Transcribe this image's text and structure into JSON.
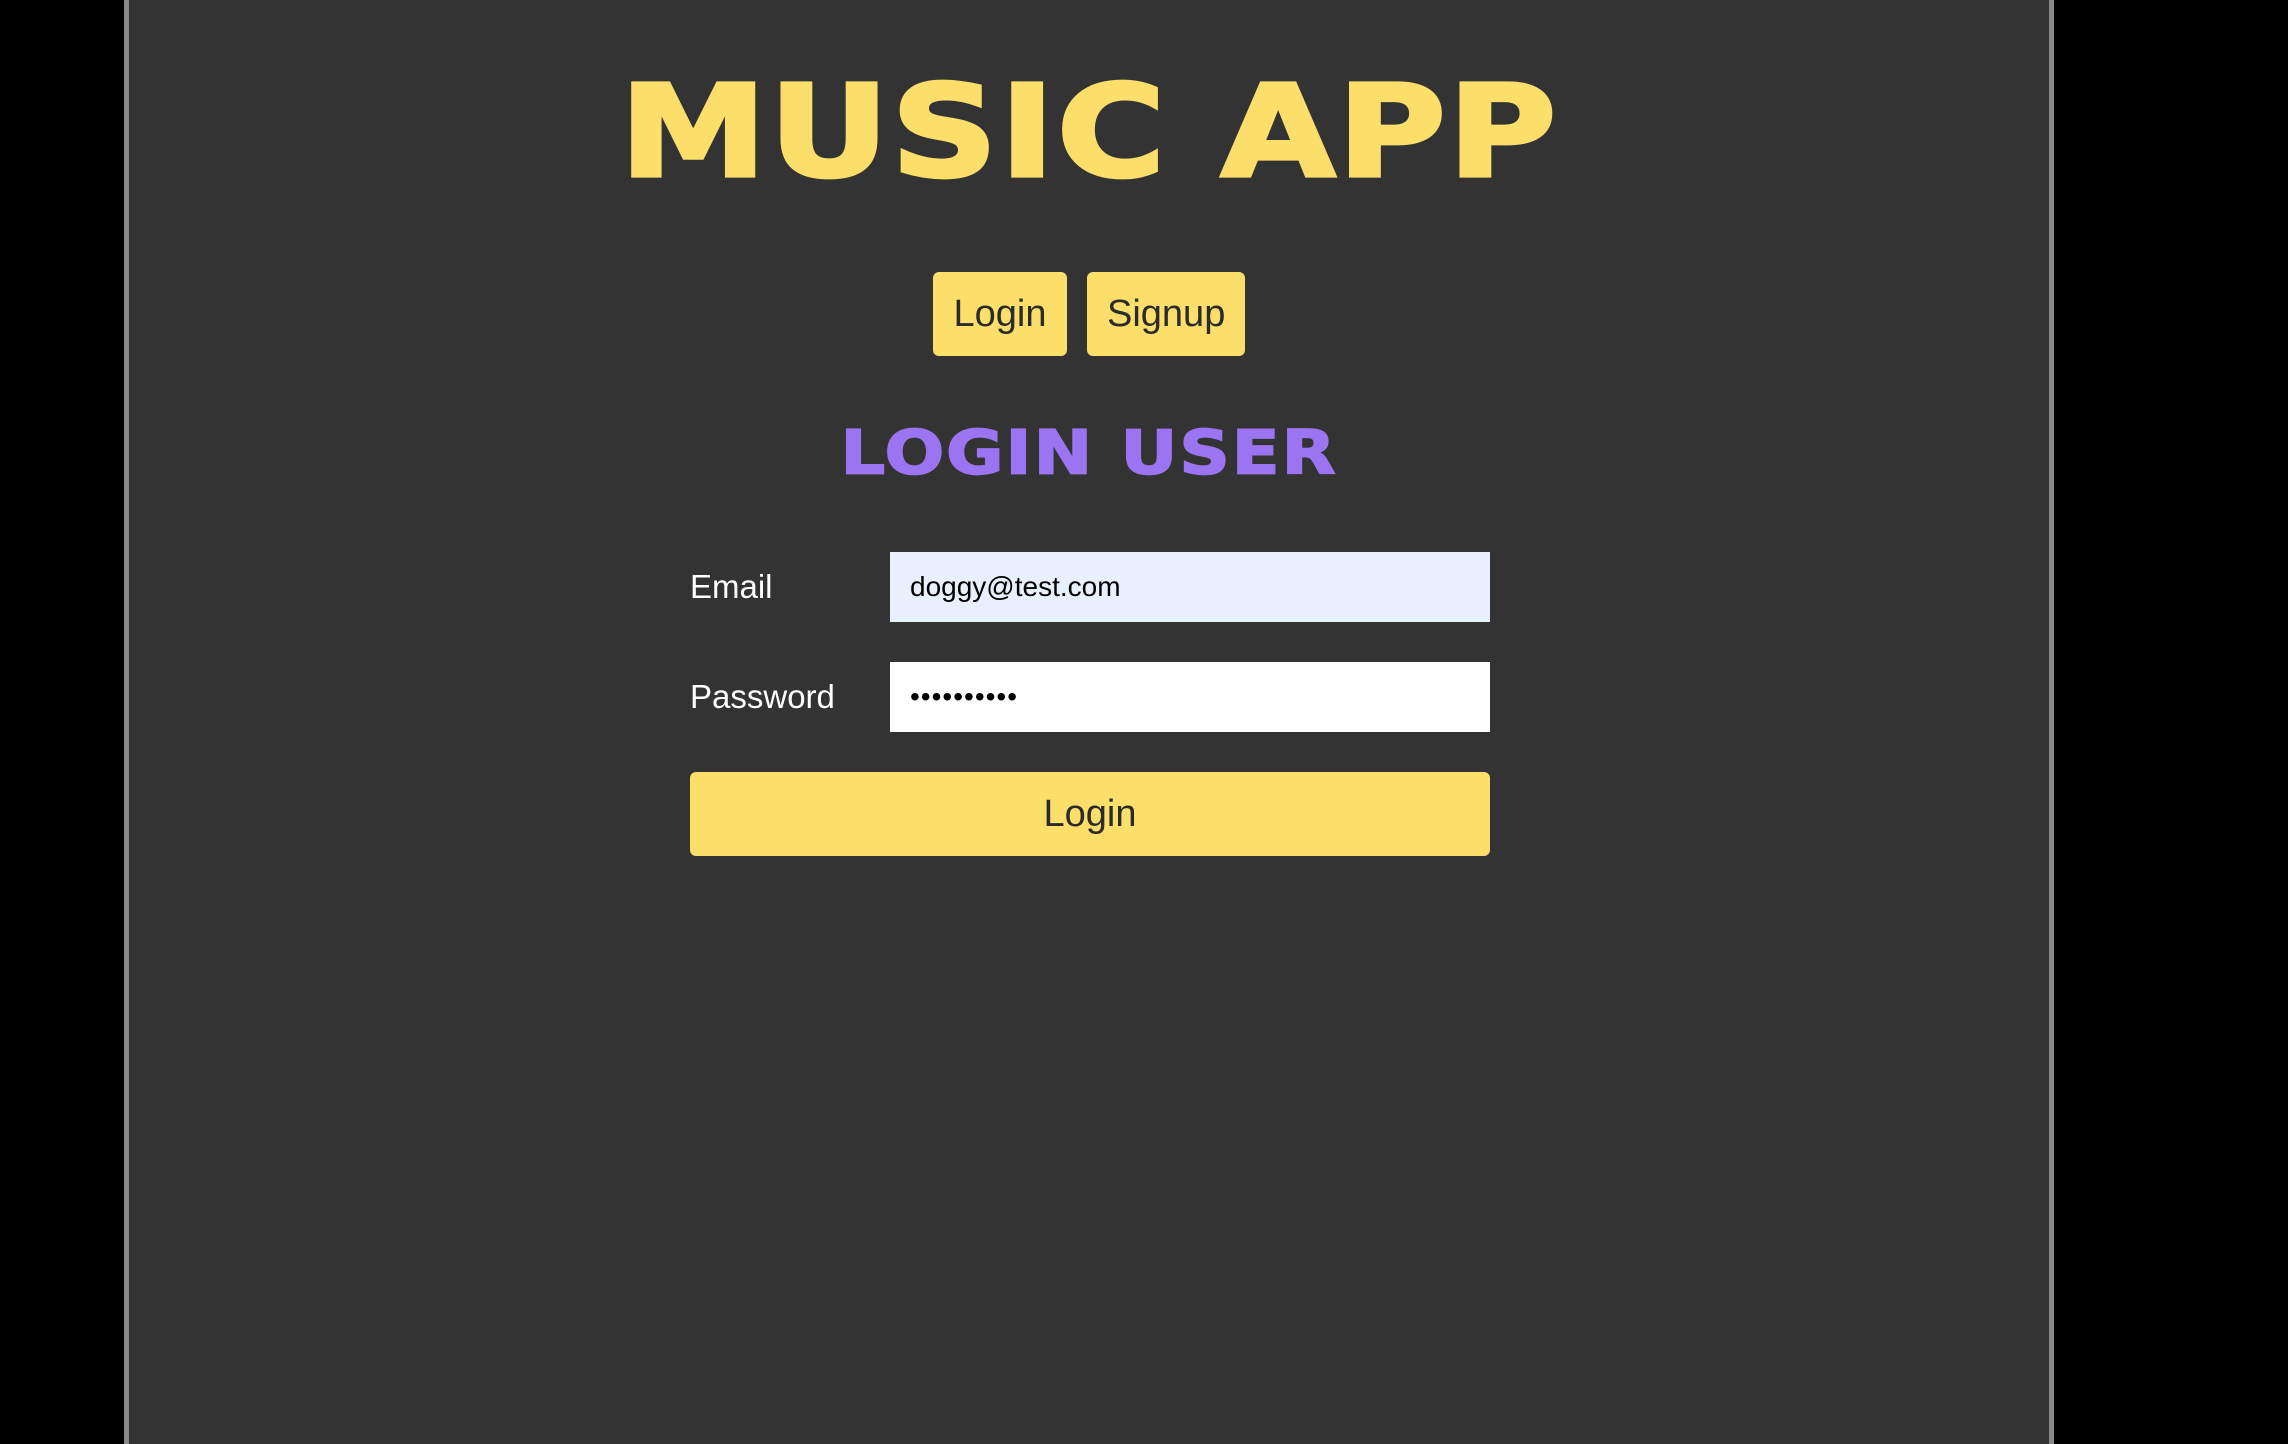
{
  "app": {
    "title": "MUSIC APP"
  },
  "nav": {
    "login_label": "Login",
    "signup_label": "Signup"
  },
  "form": {
    "heading": "LOGIN USER",
    "email_label": "Email",
    "email_value": "doggy@test.com",
    "password_label": "Password",
    "password_value": "••••••••••",
    "submit_label": "Login"
  },
  "colors": {
    "accent_yellow": "#fcde6a",
    "accent_purple": "#9b74f2",
    "panel_bg": "#333333",
    "autofill_bg": "#e8f0fe"
  }
}
